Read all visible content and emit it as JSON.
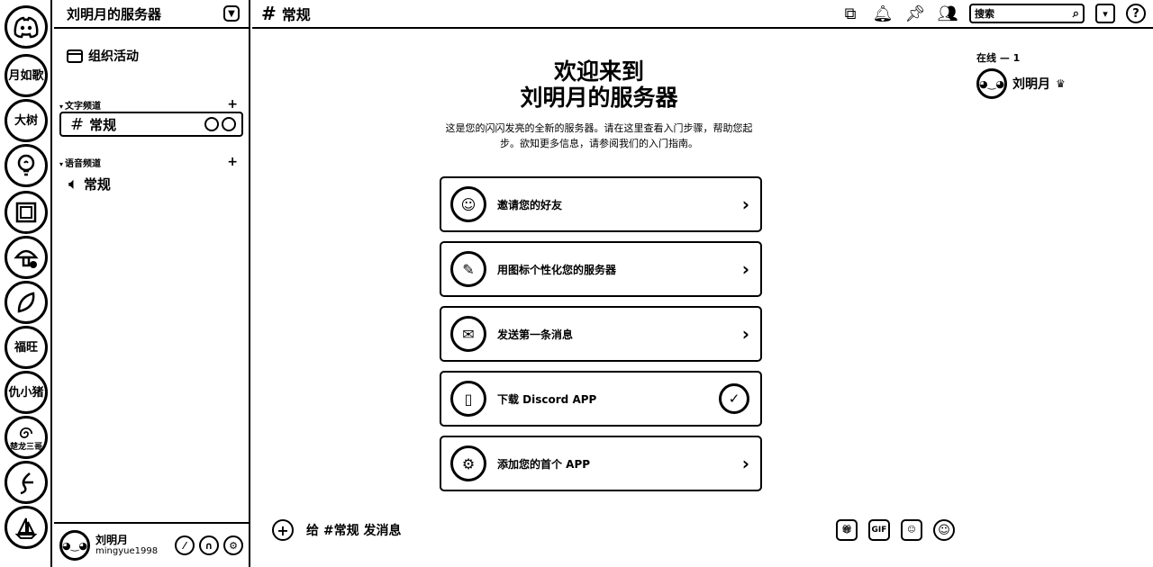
{
  "rail": {
    "servers": [
      {
        "label": "",
        "icon": "discord-icon"
      },
      {
        "label": "月如歌",
        "icon": ""
      },
      {
        "label": "大树",
        "icon": ""
      },
      {
        "label": "",
        "icon": "lightbulb-face-icon"
      },
      {
        "label": "",
        "icon": "framed-picture-icon"
      },
      {
        "label": "",
        "icon": "mushroom-icon"
      },
      {
        "label": "",
        "icon": "leaf-icon"
      },
      {
        "label": "福旺",
        "icon": ""
      },
      {
        "label": "仇小猪",
        "icon": ""
      },
      {
        "label": "楚龙三哥",
        "icon": "swirl-icon"
      },
      {
        "label": "",
        "icon": "signature-icon"
      },
      {
        "label": "",
        "icon": "sailboat-icon"
      }
    ]
  },
  "sidebar": {
    "server_name": "刘明月的服务器",
    "events_label": "组织活动",
    "text_category": "文字频道",
    "voice_category": "语音频道",
    "text_channel": "常规",
    "voice_channel": "常规"
  },
  "user": {
    "display_name": "刘明月",
    "username": "mingyue1998"
  },
  "topbar": {
    "channel_name": "常规",
    "search_placeholder": "搜索"
  },
  "welcome": {
    "title_line1": "欢迎来到",
    "title_line2": "刘明月的服务器",
    "description": "这是您的闪闪发亮的全新的服务器。请在这里查看入门步骤，帮助您起步。欲知更多信息，请参阅我们的入门指南。"
  },
  "cards": [
    {
      "label": "邀请您的好友",
      "icon": "invite-friends-icon",
      "status": "arrow"
    },
    {
      "label": "用图标个性化您的服务器",
      "icon": "paint-brush-icon",
      "status": "arrow"
    },
    {
      "label": "发送第一条消息",
      "icon": "chat-bubble-icon",
      "status": "arrow"
    },
    {
      "label": "下载 Discord APP",
      "icon": "phone-download-icon",
      "status": "done"
    },
    {
      "label": "添加您的首个 APP",
      "icon": "robot-app-icon",
      "status": "arrow"
    }
  ],
  "composer": {
    "placeholder": "给 #常规 发消息"
  },
  "members": {
    "online_header": "在线 — 1",
    "list": [
      {
        "name": "刘明月",
        "owner": true
      }
    ]
  }
}
